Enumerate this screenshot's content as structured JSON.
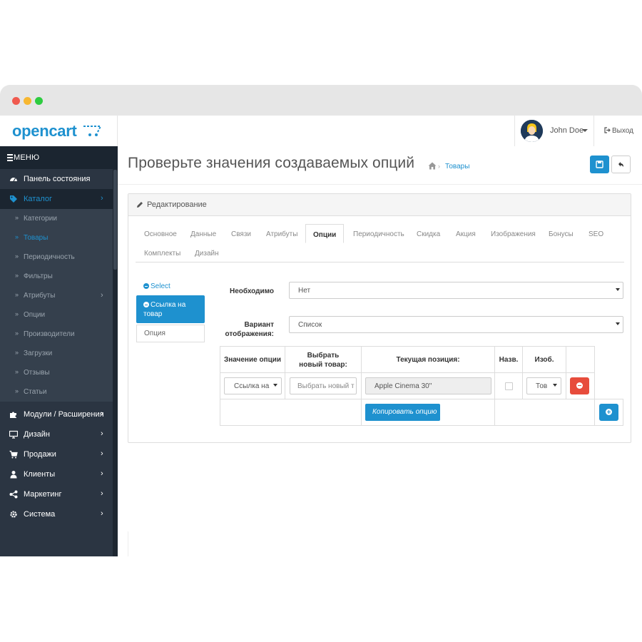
{
  "header": {
    "logo_text": "opencart",
    "user_name": "John Doe",
    "logout_label": "Выход"
  },
  "sidebar": {
    "menu_label": "МЕНЮ",
    "items": [
      {
        "label": "Панель состояния",
        "icon": "dashboard-icon"
      },
      {
        "label": "Каталог",
        "icon": "tag-icon",
        "active": true
      },
      {
        "label": "Модули / Расширения",
        "icon": "puzzle-icon"
      },
      {
        "label": "Дизайн",
        "icon": "monitor-icon"
      },
      {
        "label": "Продажи",
        "icon": "cart-icon"
      },
      {
        "label": "Клиенты",
        "icon": "user-icon"
      },
      {
        "label": "Маркетинг",
        "icon": "share-icon"
      },
      {
        "label": "Система",
        "icon": "gear-icon"
      }
    ],
    "catalog_sub": [
      "Категории",
      "Товары",
      "Периодичность",
      "Фильтры",
      "Атрибуты",
      "Опции",
      "Производители",
      "Загрузки",
      "Отзывы",
      "Статьи"
    ],
    "chevron": "›",
    "raquo": "»"
  },
  "page": {
    "title": "Проверьте значения создаваемых опций",
    "breadcrumb_link": "Товары"
  },
  "panel": {
    "heading": "Редактирование",
    "tabs": [
      "Основное",
      "Данные",
      "Связи",
      "Атрибуты",
      "Опции",
      "Периодичность",
      "Скидка",
      "Акция",
      "Изображения",
      "Бонусы",
      "SEO",
      "Комплекты",
      "Дизайн"
    ],
    "active_tab": "Опции",
    "vtabs": {
      "select": "Select",
      "active": "Ссылка на товар",
      "plain": "Опция"
    },
    "fields": {
      "required_label": "Необходимо",
      "required_value": "Нет",
      "display_label": "Вариант отображения:",
      "display_value": "Список"
    },
    "table": {
      "headers": [
        "Значение опции",
        "Выбрать новый товар:",
        "Текущая позиция:",
        "Назв.",
        "Изоб."
      ],
      "row": {
        "option_value": "Ссылка на",
        "new_product_placeholder": "Выбрать новый т",
        "current_position": "Apple Cinema 30\"",
        "image_select": "Тов"
      },
      "copy_button": "Копировать опцию"
    }
  },
  "colors": {
    "accent": "#1e91cf",
    "sidebar": "#2b3542",
    "danger": "#e74c3c"
  }
}
